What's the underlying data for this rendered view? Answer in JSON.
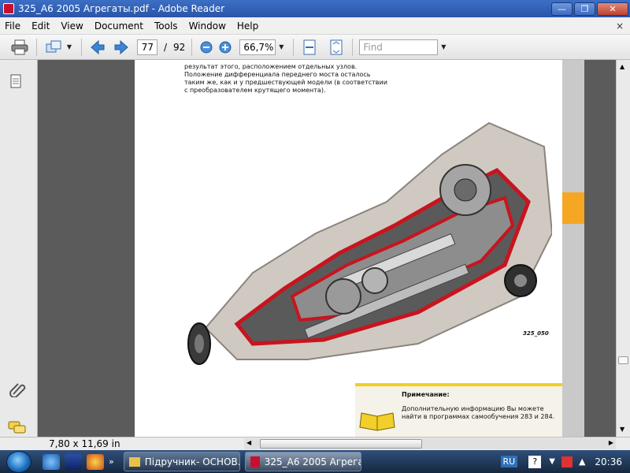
{
  "window": {
    "title": "325_A6 2005 Агрегаты.pdf - Adobe Reader"
  },
  "menubar": {
    "items": [
      "File",
      "Edit",
      "View",
      "Document",
      "Tools",
      "Window",
      "Help"
    ],
    "close_glyph": "×"
  },
  "toolbar": {
    "page_current": "77",
    "page_sep": "/",
    "page_total": "92",
    "zoom": "66,7%",
    "find_placeholder": "Find"
  },
  "document": {
    "body_text": "результат этого, расположением отдельных узлов. Положение дифференциала переднего моста осталось таким же, как и у предшествующей модели (в соответствии с преобразователем крутящего момента).",
    "figure_label": "325_050",
    "note": {
      "title": "Примечание:",
      "text": "Дополнительную информацию Вы можете найти в программах самообучения 283 и 284."
    }
  },
  "status": {
    "page_size": "7,80 x 11,69 in"
  },
  "taskbar": {
    "tasks": [
      {
        "label": "Підручник- ОСНОВ..."
      },
      {
        "label": "325_A6 2005 Агрега..."
      }
    ],
    "lang": "RU",
    "clock": "20:36"
  },
  "colors": {
    "accent": "#f5a623",
    "note_bar": "#f2d01c",
    "title_bar": "#2a55a8"
  }
}
